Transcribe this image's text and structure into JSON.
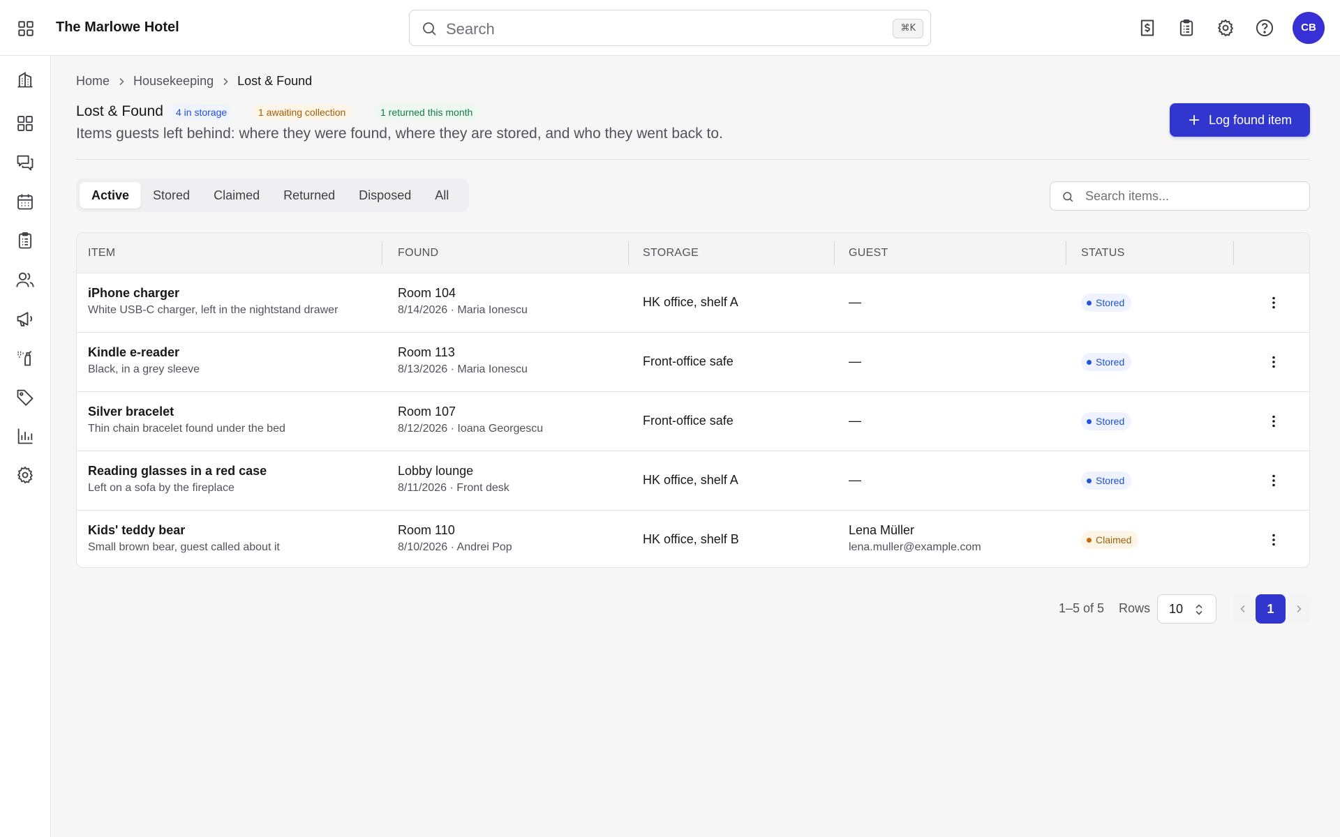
{
  "app": {
    "title": "The Marlowe Hotel"
  },
  "header": {
    "search_placeholder": "Search",
    "search_shortcut": "⌘K",
    "user_initials": "CB",
    "icons": [
      "billing-icon",
      "clipboard-icon",
      "gear-icon",
      "help-icon"
    ]
  },
  "sidebar": {
    "icons": [
      "building-icon",
      "dashboard-icon",
      "messages-icon",
      "calendar-icon",
      "clipboard-icon",
      "guests-icon",
      "megaphone-icon",
      "housekeeping-icon",
      "tag-icon",
      "reports-icon",
      "settings-icon"
    ]
  },
  "breadcrumb": [
    "Home",
    "Housekeeping",
    "Lost & Found"
  ],
  "page": {
    "title": "Lost & Found",
    "badges": {
      "storage": "4 in storage",
      "awaiting": "1 awaiting collection",
      "returned": "1 returned this month"
    },
    "subtitle": "Items guests left behind: where they were found, where they are stored, and who they went back to.",
    "primary_action": "Log found item"
  },
  "tabs": [
    "Active",
    "Stored",
    "Claimed",
    "Returned",
    "Disposed",
    "All"
  ],
  "active_tab": "Active",
  "items_search": {
    "placeholder": "Search items..."
  },
  "table": {
    "columns": [
      "ITEM",
      "FOUND",
      "STORAGE",
      "GUEST",
      "STATUS"
    ],
    "rows": [
      {
        "item": "iPhone charger",
        "description": "White USB-C charger, left in the nightstand drawer",
        "location": "Room 104",
        "found_meta": "8/14/2026 · Maria Ionescu",
        "storage": "HK office, shelf A",
        "guest": "—",
        "guest_email": "",
        "status": "Stored"
      },
      {
        "item": "Kindle e-reader",
        "description": "Black, in a grey sleeve",
        "location": "Room 113",
        "found_meta": "8/13/2026 · Maria Ionescu",
        "storage": "Front-office safe",
        "guest": "—",
        "guest_email": "",
        "status": "Stored"
      },
      {
        "item": "Silver bracelet",
        "description": "Thin chain bracelet found under the bed",
        "location": "Room 107",
        "found_meta": "8/12/2026 · Ioana Georgescu",
        "storage": "Front-office safe",
        "guest": "—",
        "guest_email": "",
        "status": "Stored"
      },
      {
        "item": "Reading glasses in a red case",
        "description": "Left on a sofa by the fireplace",
        "location": "Lobby lounge",
        "found_meta": "8/11/2026 · Front desk",
        "storage": "HK office, shelf A",
        "guest": "—",
        "guest_email": "",
        "status": "Stored"
      },
      {
        "item": "Kids' teddy bear",
        "description": "Small brown bear, guest called about it",
        "location": "Room 110",
        "found_meta": "8/10/2026 · Andrei Pop",
        "storage": "HK office, shelf B",
        "guest": "Lena Müller",
        "guest_email": "lena.muller@example.com",
        "status": "Claimed"
      }
    ]
  },
  "pagination": {
    "range": "1–5 of 5",
    "rows_label": "Rows",
    "rows_per_page": "10",
    "current_page": "1"
  },
  "colors": {
    "accent": "#3136cf",
    "stored": "#1e4fd8",
    "claimed": "#a15c07"
  }
}
